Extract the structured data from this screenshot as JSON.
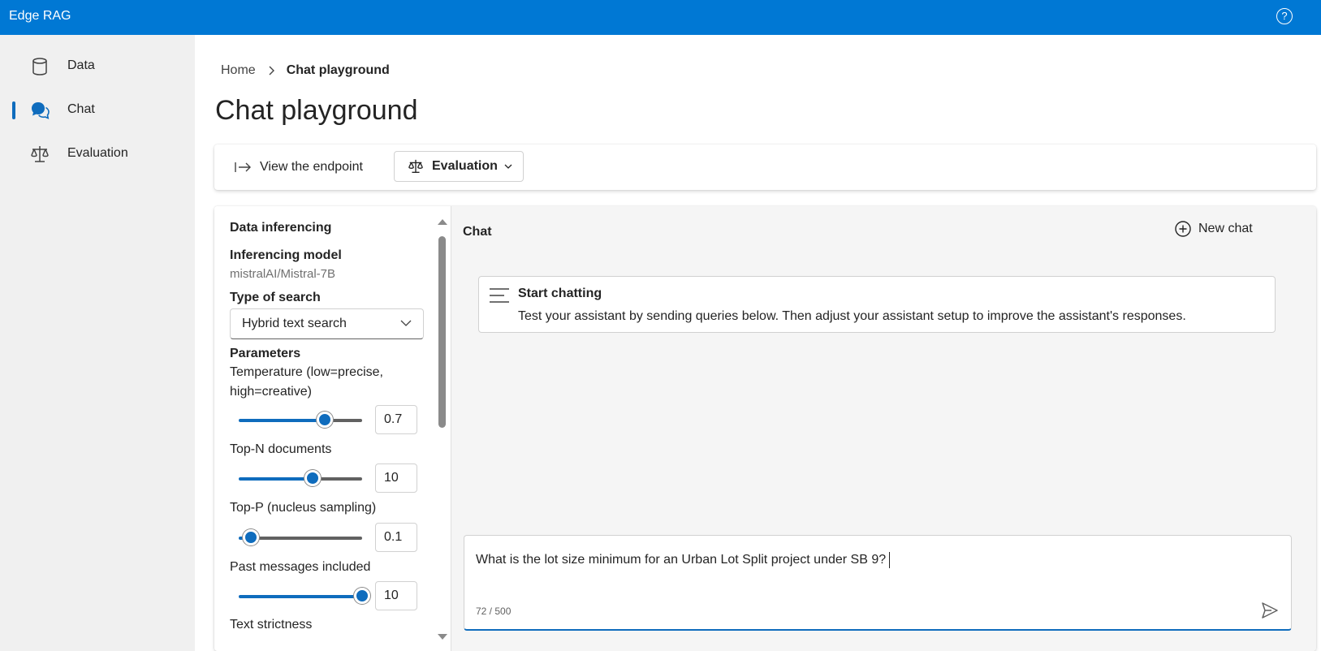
{
  "app": {
    "title": "Edge RAG",
    "help_glyph": "?"
  },
  "sidebar": {
    "items": [
      {
        "label": "Data",
        "icon": "database-icon",
        "active": false
      },
      {
        "label": "Chat",
        "icon": "chat-icon",
        "active": true
      },
      {
        "label": "Evaluation",
        "icon": "scales-icon",
        "active": false
      }
    ]
  },
  "breadcrumb": {
    "home": "Home",
    "current": "Chat playground"
  },
  "page": {
    "title": "Chat playground"
  },
  "toolbar": {
    "endpoint_label": "View the endpoint",
    "evaluation_label": "Evaluation"
  },
  "settings": {
    "section_title": "Data inferencing",
    "model_label": "Inferencing model",
    "model_value": "mistralAI/Mistral-7B",
    "search_type_label": "Type of search",
    "search_type_value": "Hybrid text search",
    "parameters_label": "Parameters",
    "temperature": {
      "label": "Temperature (low=precise, high=creative)",
      "value": "0.7",
      "fraction": 0.7
    },
    "top_n": {
      "label": "Top-N documents",
      "value": "10",
      "fraction": 0.6
    },
    "top_p": {
      "label": "Top-P (nucleus sampling)",
      "value": "0.1",
      "fraction": 0.1
    },
    "past_messages": {
      "label": "Past messages included",
      "value": "10",
      "fraction": 1.0
    },
    "text_strictness_label": "Text strictness"
  },
  "chat": {
    "title": "Chat",
    "new_chat_label": "New chat",
    "start_title": "Start chatting",
    "start_desc": "Test your assistant by sending queries below. Then adjust your assistant setup to improve the assistant's responses.",
    "input_value": "What is the lot size minimum for an Urban Lot Split project under SB 9?",
    "counter": "72 / 500"
  },
  "colors": {
    "brand": "#0078d4",
    "accent": "#0f6cbd",
    "track_inactive": "#616161"
  }
}
